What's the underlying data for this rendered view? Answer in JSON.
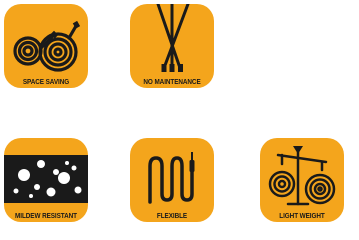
{
  "colors": {
    "accent": "#F4A51C",
    "stroke": "#1A1A1A",
    "label_text": "#1A1A1A",
    "inverse_text": "#FFFFFF",
    "bubble": "#FFFFFF"
  },
  "features": [
    {
      "label": "SPACE SAVING",
      "icon": "coiled-hose-icon"
    },
    {
      "label": "NO MAINTENANCE",
      "icon": "pole-tripod-icon"
    },
    {
      "label": "MILDEW RESISTANT",
      "icon": "mildew-bubbles-icon"
    },
    {
      "label": "FLEXIBLE",
      "icon": "flexible-hose-icon"
    },
    {
      "label": "LIGHT WEIGHT",
      "icon": "scale-balance-icon"
    }
  ]
}
